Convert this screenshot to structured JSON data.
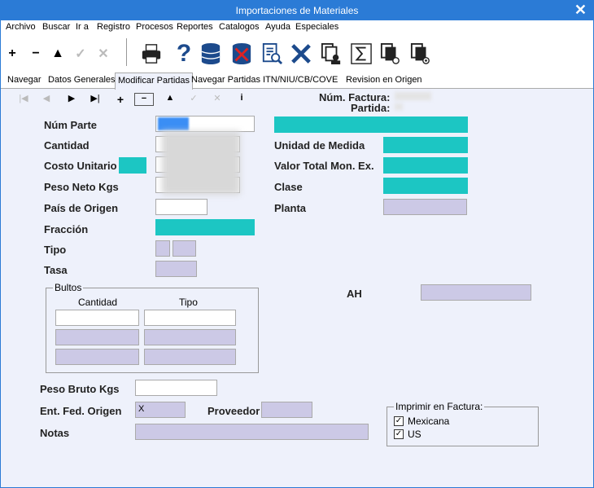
{
  "window": {
    "title": "Importaciones de Materiales",
    "close_glyph": "✕"
  },
  "menu": [
    "Archivo",
    "Buscar",
    "Ir a",
    "Registro",
    "Procesos",
    "Reportes",
    "Catalogos",
    "Ayuda",
    "Especiales"
  ],
  "toolbar_icons": [
    "add-icon",
    "remove-icon",
    "up-icon",
    "confirm-icon",
    "cancel-icon",
    "print-icon",
    "help-icon",
    "database-icon",
    "database-delete-icon",
    "report-search-icon",
    "delete-icon",
    "document-user-icon",
    "sum-icon",
    "documents-icon",
    "document-settings-icon"
  ],
  "tabs": [
    "Navegar",
    "Datos Generales",
    "Modificar Partidas",
    "Navegar Partidas",
    "ITN/NIU/CB/COVE",
    "Revision en Origen"
  ],
  "active_tab": "Modificar Partidas",
  "header": {
    "factura_label": "Núm. Factura:",
    "partida_label": "Partida:"
  },
  "labels": {
    "num_parte": "Núm Parte",
    "cantidad": "Cantidad",
    "costo_unitario": "Costo Unitario",
    "peso_neto": "Peso Neto Kgs",
    "pais_origen": "País de Origen",
    "fraccion": "Fracción",
    "tipo": "Tipo",
    "tasa": "Tasa",
    "unidad_medida": "Unidad de Medida",
    "valor_total": "Valor Total Mon. Ex.",
    "clase": "Clase",
    "planta": "Planta",
    "ah": "AH",
    "peso_bruto": "Peso Bruto Kgs",
    "ent_fed_origen": "Ent. Fed. Origen",
    "proveedor": "Proveedor",
    "notas": "Notas"
  },
  "bultos": {
    "title": "Bultos",
    "col_cantidad": "Cantidad",
    "col_tipo": "Tipo"
  },
  "imprimir": {
    "title": "Imprimir en Factura:",
    "options": [
      {
        "label": "Mexicana",
        "checked": true
      },
      {
        "label": "US",
        "checked": true
      }
    ]
  },
  "values": {
    "ent_fed_origen": "X"
  }
}
